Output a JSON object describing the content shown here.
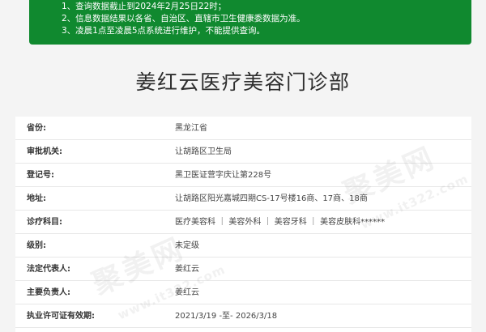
{
  "notice": {
    "lines": [
      "1、查询数据截止到2024年2月25日22时；",
      "2、信息数据结果以各省、自治区、直辖市卫生健康委数据为准。",
      "3、凌晨1点至凌晨5点系统进行维护，不能提供查询。"
    ]
  },
  "title": "姜红云医疗美容门诊部",
  "rows": [
    {
      "label": "省份:",
      "value": "黑龙江省"
    },
    {
      "label": "审批机关:",
      "value": "让胡路区卫生局"
    },
    {
      "label": "登记号:",
      "value": "黑卫医证营字庆让第228号"
    },
    {
      "label": "地址:",
      "value": "让胡路区阳光嘉城四期CS-17号楼16商、17商、18商"
    },
    {
      "label": "诊疗科目:",
      "value": "医疗美容科 ｜ 美容外科 ｜ 美容牙科 ｜ 美容皮肤科******"
    },
    {
      "label": "级别:",
      "value": "未定级"
    },
    {
      "label": "法定代表人:",
      "value": "姜红云"
    },
    {
      "label": "主要负责人:",
      "value": "姜红云"
    },
    {
      "label": "执业许可证有效期:",
      "value": "2021/3/19 -至- 2026/3/18"
    }
  ],
  "watermarks": {
    "brand": "聚美网",
    "site": "www.it322.com"
  }
}
